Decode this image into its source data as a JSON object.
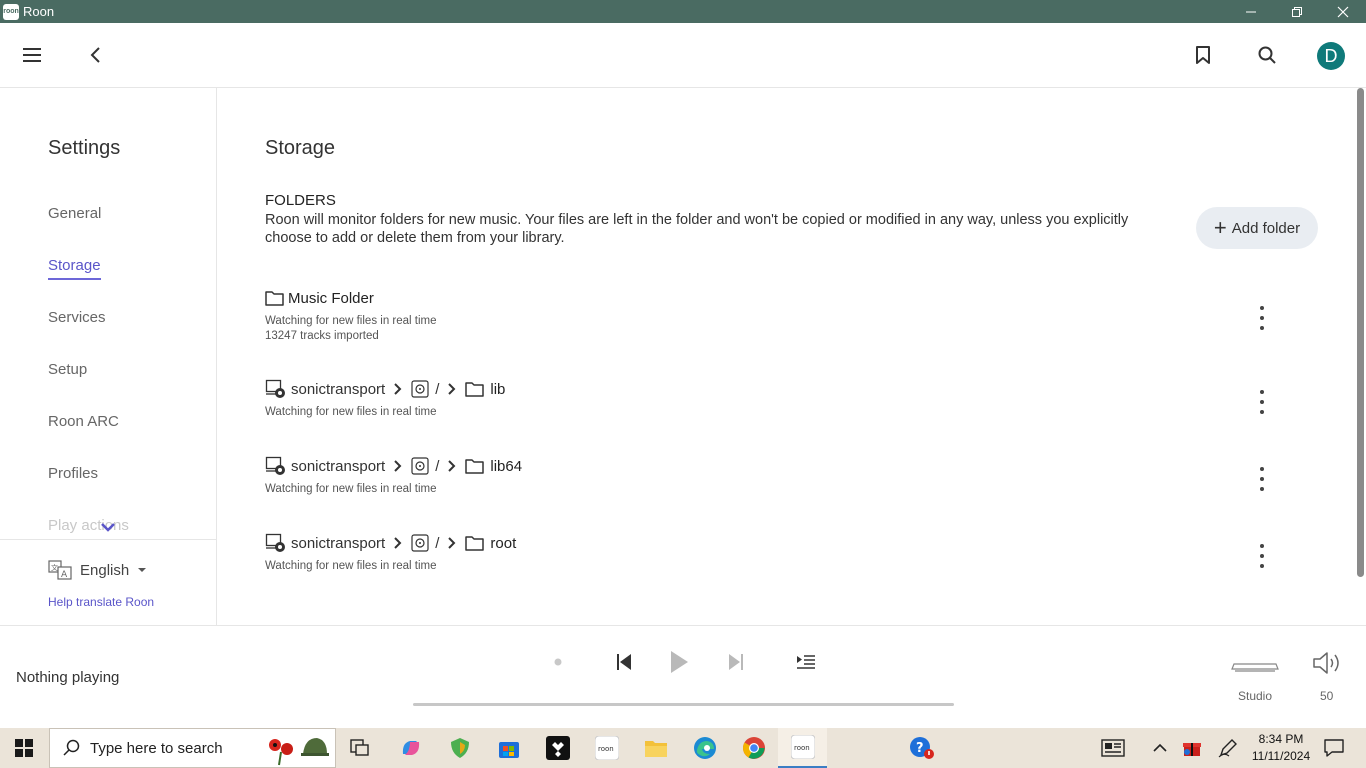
{
  "window": {
    "title": "Roon",
    "app_icon_text": "roon"
  },
  "sidebar": {
    "heading": "Settings",
    "items": [
      {
        "label": "General"
      },
      {
        "label": "Storage"
      },
      {
        "label": "Services"
      },
      {
        "label": "Setup"
      },
      {
        "label": "Roon ARC"
      },
      {
        "label": "Profiles"
      },
      {
        "label": "Play actions"
      }
    ],
    "active_item": "Storage",
    "language": "English",
    "help_link": "Help translate Roon"
  },
  "user": {
    "avatar_letter": "D"
  },
  "main": {
    "title": "Storage",
    "section_title": "FOLDERS",
    "section_description": "Roon will monitor folders for new music. Your files are left in the folder and won't be copied or modified in any way, unless you explicitly choose to add or delete them from your library.",
    "add_folder_label": "Add folder",
    "folders": [
      {
        "name": "Music Folder",
        "status": "Watching for new files in real time",
        "tracks": "13247 tracks imported"
      },
      {
        "host": "sonictransport",
        "root": "/",
        "name": "lib",
        "status": "Watching for new files in real time"
      },
      {
        "host": "sonictransport",
        "root": "/",
        "name": "lib64",
        "status": "Watching for new files in real time"
      },
      {
        "host": "sonictransport",
        "root": "/",
        "name": "root",
        "status": "Watching for new files in real time"
      }
    ]
  },
  "player": {
    "now_playing": "Nothing playing",
    "zone": "Studio",
    "volume": "50"
  },
  "taskbar": {
    "search_placeholder": "Type here to search",
    "time": "8:34 PM",
    "date": "11/11/2024"
  },
  "colors": {
    "titlebar": "#4a6b62",
    "accent": "#5a55c9",
    "avatar": "#0f7a7a",
    "taskbar": "#ebe4d9"
  }
}
